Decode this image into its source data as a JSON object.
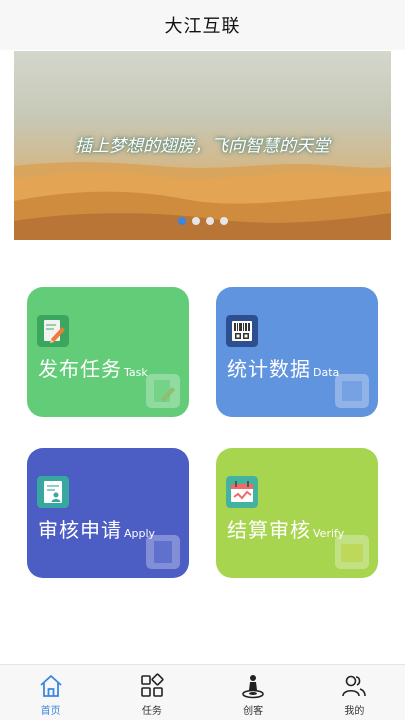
{
  "header": {
    "title": "大江互联"
  },
  "banner": {
    "slogan": "插上梦想的翅膀，飞向智慧的天堂",
    "slide_count": 4,
    "active_slide": 1
  },
  "cards": [
    {
      "key": "task",
      "title": "发布任务",
      "subtitle": "Task",
      "color": "#63cc78",
      "icon": "edit-document-icon"
    },
    {
      "key": "data",
      "title": "统计数据",
      "subtitle": "Data",
      "color": "#6194de",
      "icon": "barcode-data-icon"
    },
    {
      "key": "apply",
      "title": "审核申请",
      "subtitle": "Apply",
      "color": "#4c5dc4",
      "icon": "applicant-form-icon"
    },
    {
      "key": "verify",
      "title": "结算审核",
      "subtitle": "Verify",
      "color": "#a8d54f",
      "icon": "calendar-check-icon"
    }
  ],
  "tabbar": {
    "items": [
      {
        "label": "首页",
        "icon": "home-icon",
        "active": true
      },
      {
        "label": "任务",
        "icon": "grid-icon",
        "active": false
      },
      {
        "label": "创客",
        "icon": "maker-icon",
        "active": false
      },
      {
        "label": "我的",
        "icon": "users-icon",
        "active": false
      }
    ],
    "active_color": "#3b86e0"
  }
}
